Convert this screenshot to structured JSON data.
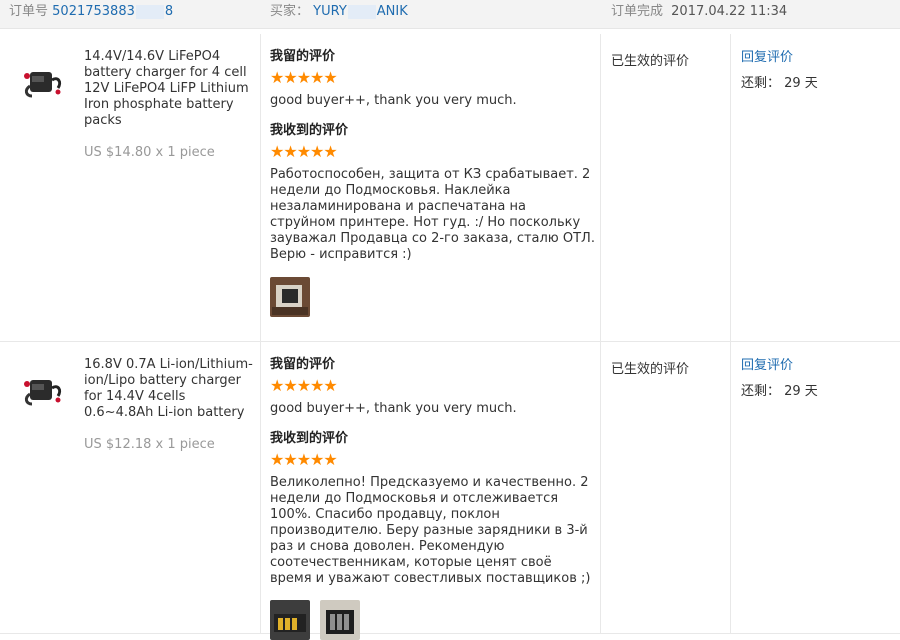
{
  "header": {
    "order_label": "订单号",
    "order_number_prefix": "5021753883",
    "order_number_suffix": "8",
    "buyer_label": "买家：",
    "buyer_prefix": "YURY",
    "buyer_suffix": "ANIK",
    "status_label": "订单完成",
    "completed_time": "2017.04.22 11:34"
  },
  "orders": [
    {
      "product_title": "14.4V/14.6V LiFePO4 battery charger for 4 cell 12V LiFePO4 LiFP Lithium Iron phosphate battery packs",
      "price": "US $14.80 x 1 piece",
      "my_review_label": "我留的评价",
      "my_stars": "★★★★★",
      "my_review_text": "good buyer++, thank you very much.",
      "received_label": "我收到的评价",
      "received_stars": "★★★★★",
      "received_text": "Работоспособен, защита от КЗ срабатывает. 2 недели до Подмосковья. Наклейка незаламинирована и распечатана на струйном принтере. Нот гуд. :/ Но поскольку зауважал Продавца со 2-го заказа, сталю ОТЛ. Верю - исправится :)",
      "status": "已生效的评价",
      "reply_label": "回复评价",
      "remaining": "还剩： 29 天"
    },
    {
      "product_title": "16.8V 0.7A Li-ion/Lithium-ion/Lipo battery charger for 14.4V 4cells 0.6~4.8Ah Li-ion battery",
      "price": "US $12.18 x 1 piece",
      "my_review_label": "我留的评价",
      "my_stars": "★★★★★",
      "my_review_text": "good buyer++, thank you very much.",
      "received_label": "我收到的评价",
      "received_stars": "★★★★★",
      "received_text": "Великолепно! Предсказуемо и качественно. 2 недели до Подмосковья и отслеживается 100%. Спасибо продавцу, поклон производителю. Беру разные зарядники в 3-й раз и снова доволен. Рекомендую соотечественникам, которые ценят своё время и уважают совестливых поставщиков ;)",
      "status": "已生效的评价",
      "reply_label": "回复评价",
      "remaining": "还剩： 29 天"
    }
  ],
  "colors": {
    "link": "#1f6cb0",
    "star": "#ff8a00",
    "header_bg": "#f3f3f3",
    "price": "#999999"
  }
}
